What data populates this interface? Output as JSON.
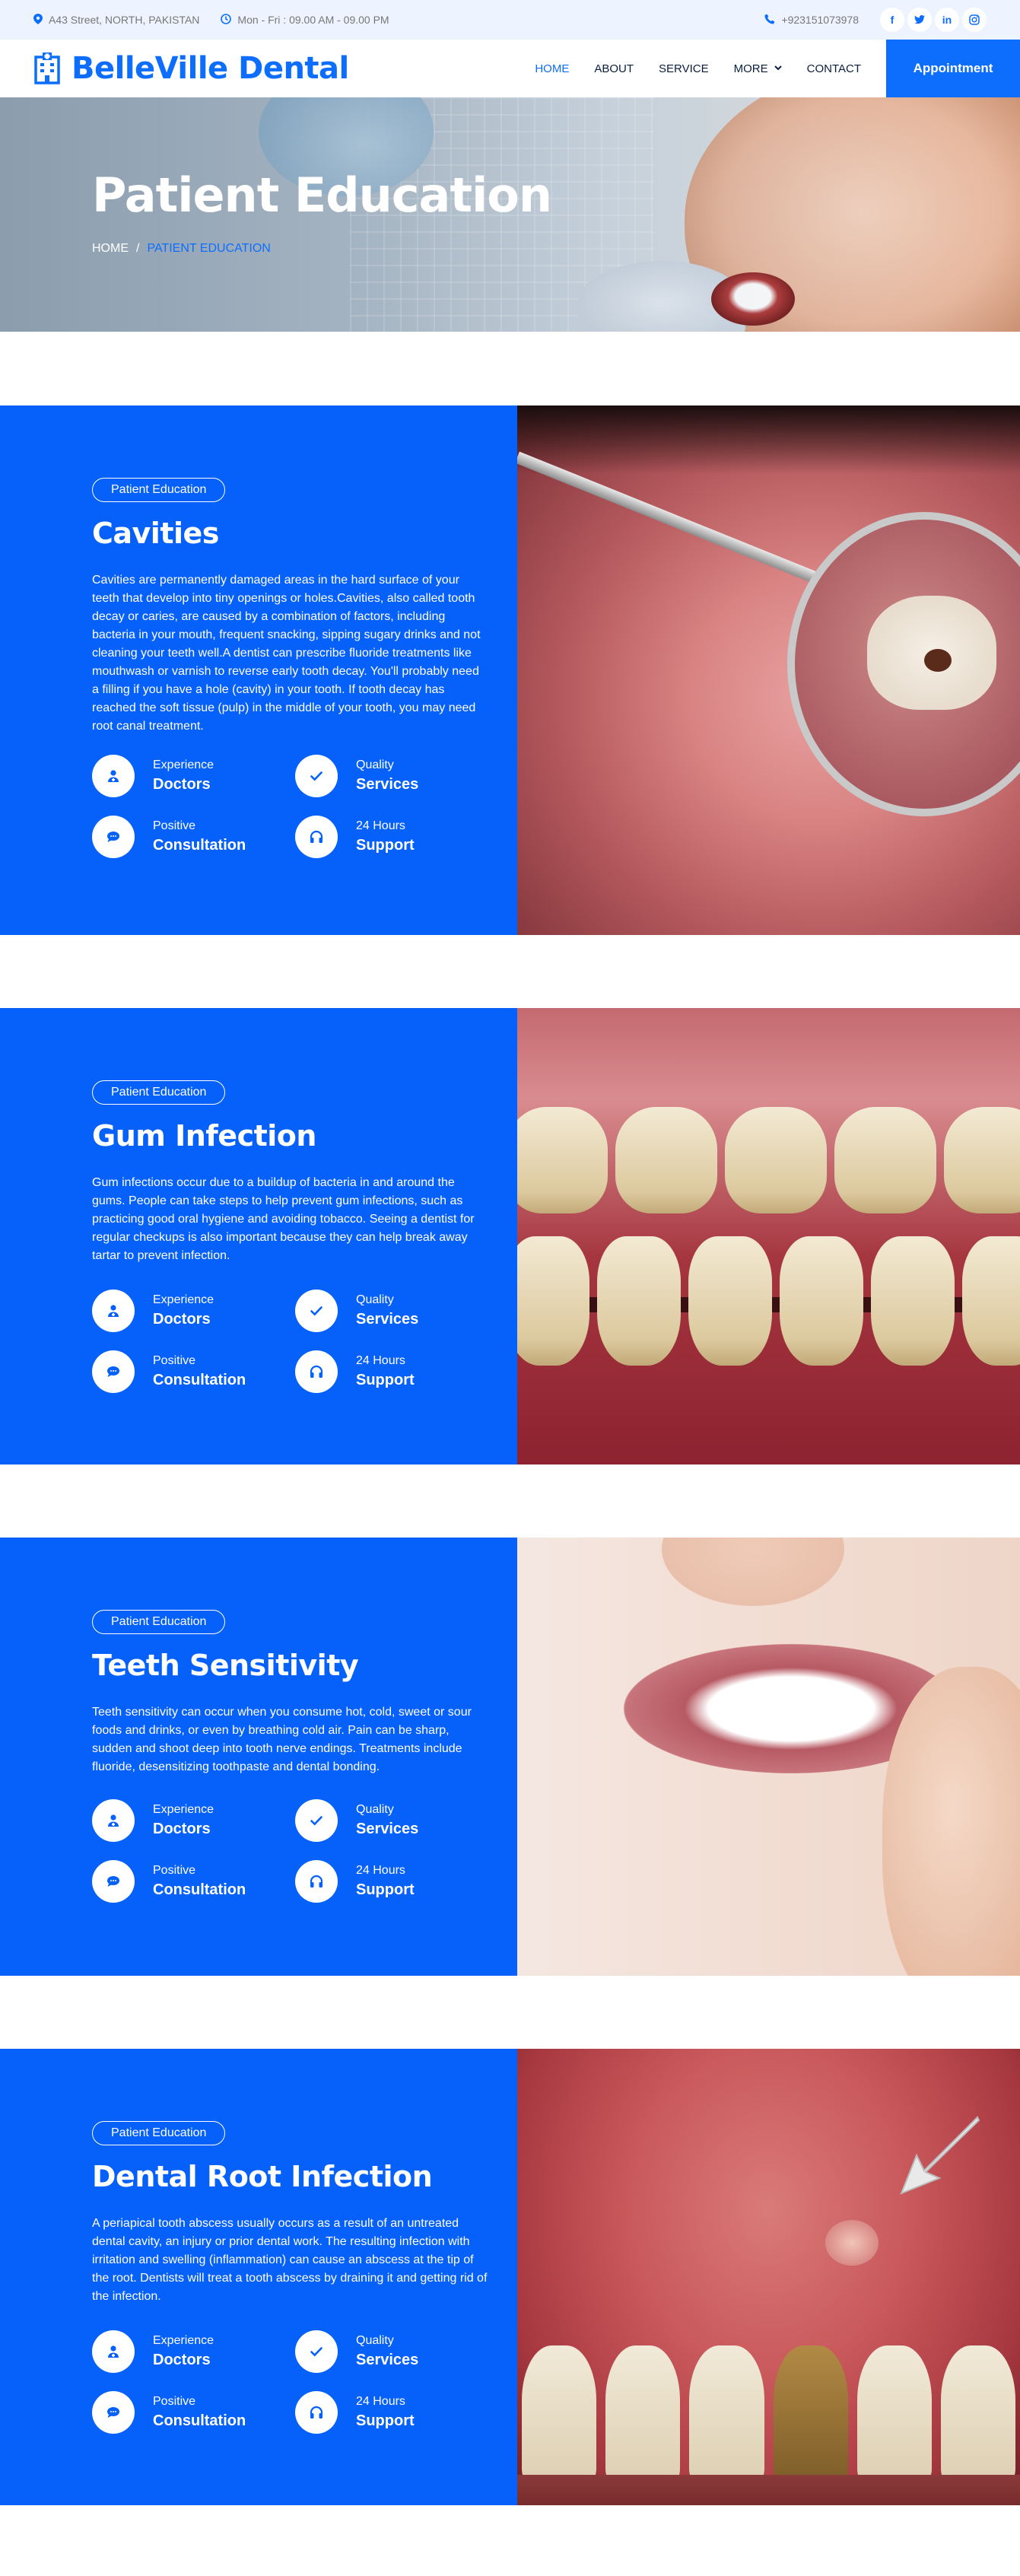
{
  "topbar": {
    "address": "A43 Street, NORTH, PAKISTAN",
    "hours": "Mon - Fri : 09.00 AM - 09.00 PM",
    "phone": "+923151073978",
    "social": [
      "f",
      "t",
      "in",
      "ig"
    ]
  },
  "nav": {
    "brand": "BelleVille Dental",
    "links": [
      "HOME",
      "ABOUT",
      "SERVICE",
      "MORE",
      "CONTACT"
    ],
    "active": "HOME",
    "appointment": "Appointment"
  },
  "hero": {
    "title": "Patient Education",
    "crumb_home": "HOME",
    "crumb_sep": "/",
    "crumb_current": "PATIENT EDUCATION"
  },
  "features": [
    {
      "top": "Experience",
      "bottom": "Doctors",
      "icon": "user-md-icon"
    },
    {
      "top": "Quality",
      "bottom": "Services",
      "icon": "check-icon"
    },
    {
      "top": "Positive",
      "bottom": "Consultation",
      "icon": "comment-icon"
    },
    {
      "top": "24 Hours",
      "bottom": "Support",
      "icon": "headphones-icon"
    }
  ],
  "sections": [
    {
      "pill": "Patient Education",
      "title": "Cavities",
      "text": "Cavities are permanently damaged areas in the hard surface of your teeth that develop into tiny openings or holes.Cavities, also called tooth decay or caries, are caused by a combination of factors, including bacteria in your mouth, frequent snacking, sipping sugary drinks and not cleaning your teeth well.A dentist can prescribe fluoride treatments like mouthwash or varnish to reverse early tooth decay. You'll probably need a filling if you have a hole (cavity) in your tooth. If tooth decay has reached the soft tissue (pulp) in the middle of your tooth, you may need root canal treatment."
    },
    {
      "pill": "Patient Education",
      "title": "Gum Infection",
      "text": "Gum infections occur due to a buildup of bacteria in and around the gums. People can take steps to help prevent gum infections, such as practicing good oral hygiene and avoiding tobacco. Seeing a dentist for regular checkups is also important because they can help break away tartar to prevent infection."
    },
    {
      "pill": "Patient Education",
      "title": "Teeth Sensitivity",
      "text": "Teeth sensitivity can occur when you consume hot, cold, sweet or sour foods and drinks, or even by breathing cold air. Pain can be sharp, sudden and shoot deep into tooth nerve endings. Treatments include fluoride, desensitizing toothpaste and dental bonding."
    },
    {
      "pill": "Patient Education",
      "title": "Dental Root Infection",
      "text": "A periapical tooth abscess usually occurs as a result of an untreated dental cavity, an injury or prior dental work. The resulting infection with irritation and swelling (inflammation) can cause an abscess at the tip of the root. Dentists will treat a tooth abscess by draining it and getting rid of the infection."
    }
  ],
  "colors": {
    "primary": "#0d6efd",
    "section_blue": "#0661FB",
    "topbar_bg": "#EDF4FF",
    "dark_text": "#091E3E"
  }
}
